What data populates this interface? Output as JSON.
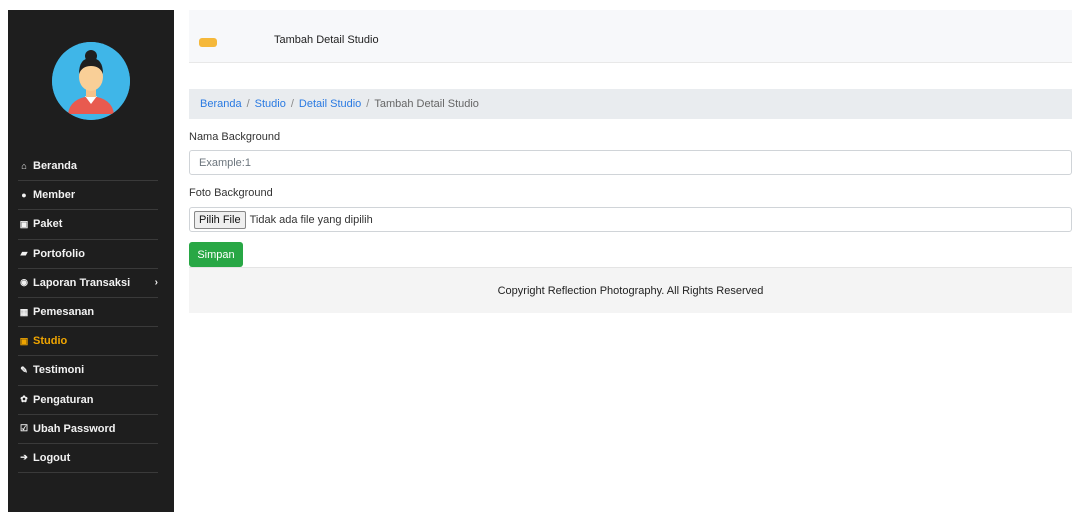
{
  "colors": {
    "sidebar_bg": "#1e1e1e",
    "accent": "#f0a500",
    "link": "#2a7ae2",
    "primary_button": "#28a745"
  },
  "sidebar": {
    "avatar_icon": "user-avatar-icon",
    "items": [
      {
        "label": "Beranda",
        "icon": "home-icon",
        "active": false
      },
      {
        "label": "Member",
        "icon": "user-icon",
        "active": false
      },
      {
        "label": "Paket",
        "icon": "image-icon",
        "active": false
      },
      {
        "label": "Portofolio",
        "icon": "book-icon",
        "active": false
      },
      {
        "label": "Laporan Transaksi",
        "icon": "globe-icon",
        "active": false,
        "has_submenu": true
      },
      {
        "label": "Pemesanan",
        "icon": "calendar-icon",
        "active": false
      },
      {
        "label": "Studio",
        "icon": "image-icon",
        "active": true
      },
      {
        "label": "Testimoni",
        "icon": "pencil-icon",
        "active": false
      },
      {
        "label": "Pengaturan",
        "icon": "gear-icon",
        "active": false
      },
      {
        "label": "Ubah Password",
        "icon": "edit-icon",
        "active": false
      },
      {
        "label": "Logout",
        "icon": "sign-out-icon",
        "active": false
      }
    ]
  },
  "header": {
    "title": "Tambah Detail Studio"
  },
  "breadcrumb": {
    "items": [
      "Beranda",
      "Studio",
      "Detail Studio"
    ],
    "current": "Tambah Detail Studio"
  },
  "form": {
    "background_name": {
      "label": "Nama Background",
      "placeholder": "Example:1"
    },
    "background_photo": {
      "label": "Foto Background",
      "button": "Pilih File",
      "status": "Tidak ada file yang dipilih"
    },
    "submit": "Simpan"
  },
  "footer": {
    "text": "Copyright Reflection Photography. All Rights Reserved"
  }
}
